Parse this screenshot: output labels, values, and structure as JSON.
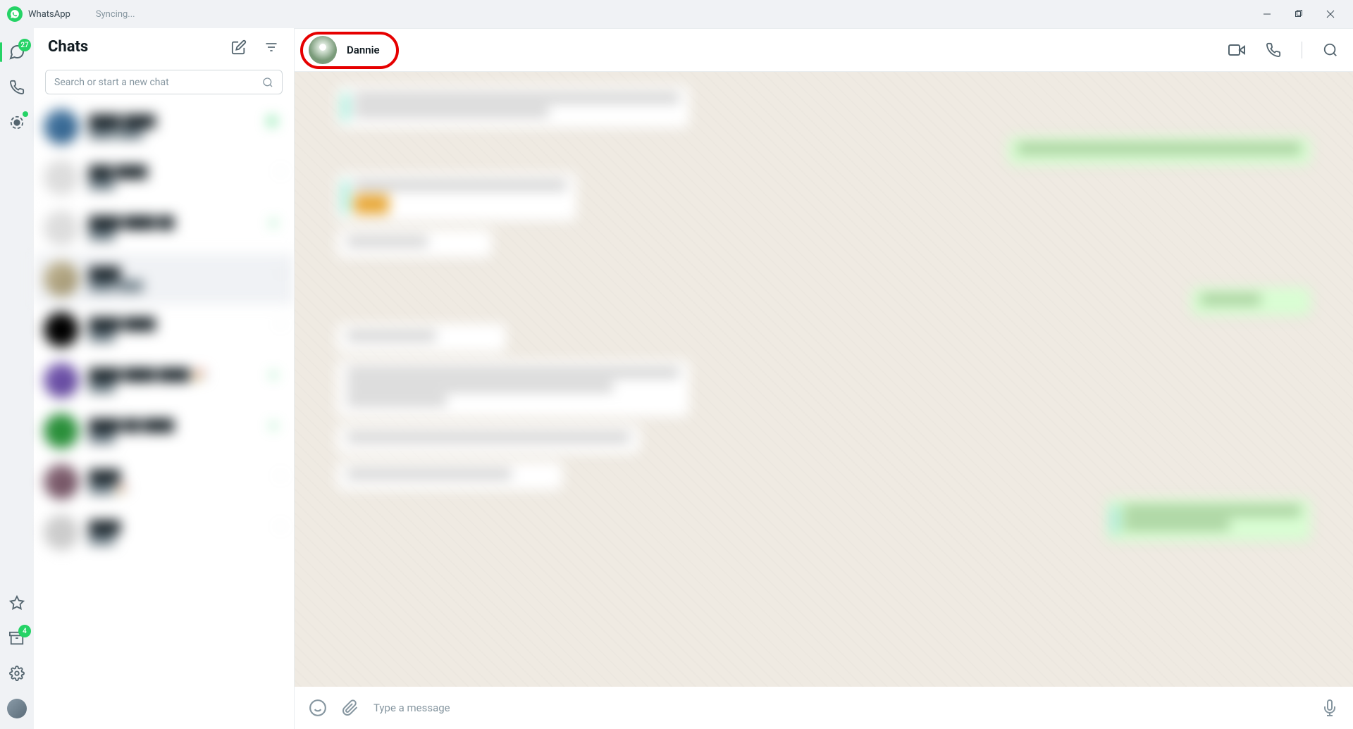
{
  "titlebar": {
    "app_name": "WhatsApp",
    "sync_status": "Syncing..."
  },
  "rail": {
    "unread_badge": "27",
    "archive_badge": "4"
  },
  "chats_panel": {
    "title": "Chats",
    "search_placeholder": "Search or start a new chat"
  },
  "conversation": {
    "contact_name": "Dannie",
    "input_placeholder": "Type a message"
  },
  "colors": {
    "brand": "#25D366",
    "highlight": "#e60000"
  }
}
